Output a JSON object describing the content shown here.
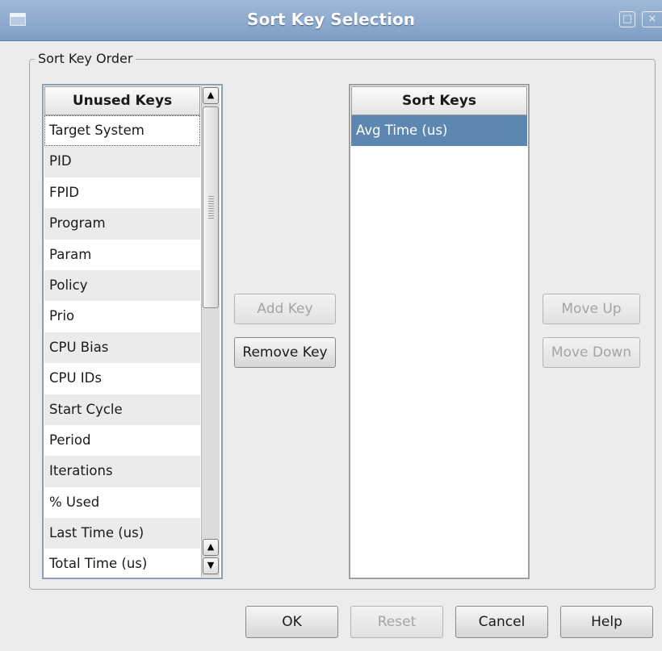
{
  "window": {
    "title": "Sort Key Selection",
    "max_glyph": "□",
    "close_glyph": "×"
  },
  "group": {
    "label": "Sort Key Order"
  },
  "unused_keys": {
    "header": "Unused Keys",
    "items": [
      "Target System",
      "PID",
      "FPID",
      "Program",
      "Param",
      "Policy",
      "Prio",
      "CPU Bias",
      "CPU IDs",
      "Start Cycle",
      "Period",
      "Iterations",
      "% Used",
      "Last Time (us)",
      "Total Time (us)"
    ],
    "scroll_up_glyph": "▲",
    "scroll_down_glyph": "▼"
  },
  "sort_keys": {
    "header": "Sort Keys",
    "items": [
      "Avg Time (us)"
    ]
  },
  "buttons": {
    "add_key": "Add Key",
    "remove_key": "Remove Key",
    "move_up": "Move Up",
    "move_down": "Move Down",
    "ok": "OK",
    "reset": "Reset",
    "cancel": "Cancel",
    "help": "Help"
  }
}
